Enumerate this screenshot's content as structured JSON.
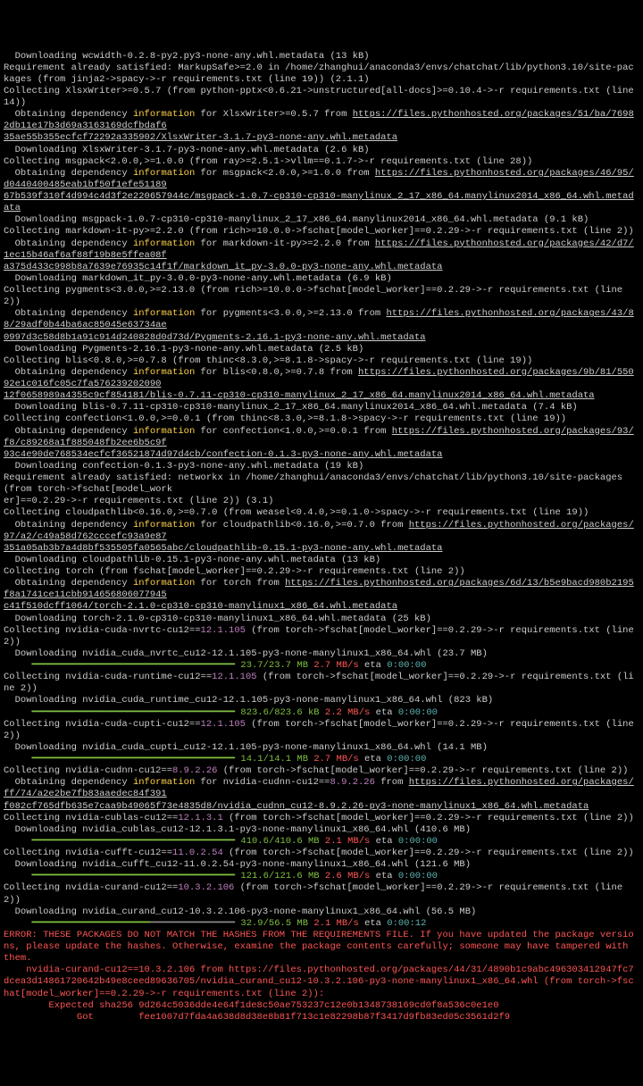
{
  "lines": [
    {
      "segs": [
        {
          "t": "  Downloading wcwidth-0.2.8-py2.py3-none-any.whl.metadata (13 kB)"
        }
      ]
    },
    {
      "segs": [
        {
          "t": "Requirement already satisfied: MarkupSafe>=2.0 in /home/zhanghui/anaconda3/envs/chatchat/lib/python3.10/site-packages (from jinja2->spacy->-r requirements.txt (line 19)) (2.1.1)"
        }
      ]
    },
    {
      "segs": [
        {
          "t": "Collecting XlsxWriter>=0.5.7 (from python-pptx<0.6.21->unstructured[all-docs]>=0.10.4->-r requirements.txt (line 14))"
        }
      ]
    },
    {
      "segs": [
        {
          "t": "  Obtaining dependency "
        },
        {
          "t": "information",
          "cls": "yellow"
        },
        {
          "t": " for XlsxWriter>=0.5.7 from "
        },
        {
          "t": "https://files.pythonhosted.org/packages/51/ba/76982db11e17b3d69a3163169dcfbdaf6",
          "cls": "underline"
        }
      ]
    },
    {
      "segs": [
        {
          "t": "35ae55b355ecfcf72292a335902/XlsxWriter-3.1.7-py3-none-any.whl.metadata",
          "cls": "underline"
        }
      ]
    },
    {
      "segs": [
        {
          "t": "  Downloading XlsxWriter-3.1.7-py3-none-any.whl.metadata (2.6 kB)"
        }
      ]
    },
    {
      "segs": [
        {
          "t": "Collecting msgpack<2.0.0,>=1.0.0 (from ray>=2.5.1->vllm==0.1.7->-r requirements.txt (line 28))"
        }
      ]
    },
    {
      "segs": [
        {
          "t": "  Obtaining dependency "
        },
        {
          "t": "information",
          "cls": "yellow"
        },
        {
          "t": " for msgpack<2.0.0,>=1.0.0 from "
        },
        {
          "t": "https://files.pythonhosted.org/packages/46/95/d0440400485eab1bf50f1efe51189",
          "cls": "underline"
        }
      ]
    },
    {
      "segs": [
        {
          "t": "67b539f310f4d994c4d3f2e220657944c/msgpack-1.0.7-cp310-cp310-manylinux_2_17_x86_64.manylinux2014_x86_64.whl.metadata",
          "cls": "underline"
        }
      ]
    },
    {
      "segs": [
        {
          "t": "  Downloading msgpack-1.0.7-cp310-cp310-manylinux_2_17_x86_64.manylinux2014_x86_64.whl.metadata (9.1 kB)"
        }
      ]
    },
    {
      "segs": [
        {
          "t": "Collecting markdown-it-py>=2.2.0 (from rich>=10.0.0->fschat[model_worker]==0.2.29->-r requirements.txt (line 2))"
        }
      ]
    },
    {
      "segs": [
        {
          "t": "  Obtaining dependency "
        },
        {
          "t": "information",
          "cls": "yellow"
        },
        {
          "t": " for markdown-it-py>=2.2.0 from "
        },
        {
          "t": "https://files.pythonhosted.org/packages/42/d7/1ec15b46af6af88f19b8e5ffea08f",
          "cls": "underline"
        }
      ]
    },
    {
      "segs": [
        {
          "t": "a375d433c998b8a7639e76935c14f1f/markdown_it_py-3.0.0-py3-none-any.whl.metadata",
          "cls": "underline"
        }
      ]
    },
    {
      "segs": [
        {
          "t": "  Downloading markdown_it_py-3.0.0-py3-none-any.whl.metadata (6.9 kB)"
        }
      ]
    },
    {
      "segs": [
        {
          "t": "Collecting pygments<3.0.0,>=2.13.0 (from rich>=10.0.0->fschat[model_worker]==0.2.29->-r requirements.txt (line 2))"
        }
      ]
    },
    {
      "segs": [
        {
          "t": "  Obtaining dependency "
        },
        {
          "t": "information",
          "cls": "yellow"
        },
        {
          "t": " for pygments<3.0.0,>=2.13.0 from "
        },
        {
          "t": "https://files.pythonhosted.org/packages/43/88/29adf0b44ba6ac85045e63734ae",
          "cls": "underline"
        }
      ]
    },
    {
      "segs": [
        {
          "t": "0997d3c58d8b1a91c914d240828d0d73d/Pygments-2.16.1-py3-none-any.whl.metadata",
          "cls": "underline"
        }
      ]
    },
    {
      "segs": [
        {
          "t": "  Downloading Pygments-2.16.1-py3-none-any.whl.metadata (2.5 kB)"
        }
      ]
    },
    {
      "segs": [
        {
          "t": "Collecting blis<0.8.0,>=0.7.8 (from thinc<8.3.0,>=8.1.8->spacy->-r requirements.txt (line 19))"
        }
      ]
    },
    {
      "segs": [
        {
          "t": "  Obtaining dependency "
        },
        {
          "t": "information",
          "cls": "yellow"
        },
        {
          "t": " for blis<0.8.0,>=0.7.8 from "
        },
        {
          "t": "https://files.pythonhosted.org/packages/9b/81/55092e1c016fc05c7fa576239202090",
          "cls": "underline"
        }
      ]
    },
    {
      "segs": [
        {
          "t": "12f0658989a4355c9cf854181/blis-0.7.11-cp310-cp310-manylinux_2_17_x86_64.manylinux2014_x86_64.whl.metadata",
          "cls": "underline"
        }
      ]
    },
    {
      "segs": [
        {
          "t": "  Downloading blis-0.7.11-cp310-cp310-manylinux_2_17_x86_64.manylinux2014_x86_64.whl.metadata (7.4 kB)"
        }
      ]
    },
    {
      "segs": [
        {
          "t": "Collecting confection<1.0.0,>=0.0.1 (from thinc<8.3.0,>=8.1.8->spacy->-r requirements.txt (line 19))"
        }
      ]
    },
    {
      "segs": [
        {
          "t": "  Obtaining dependency "
        },
        {
          "t": "information",
          "cls": "yellow"
        },
        {
          "t": " for confection<1.0.0,>=0.0.1 from "
        },
        {
          "t": "https://files.pythonhosted.org/packages/93/f8/c89268a1f885048fb2ee6b5c9f",
          "cls": "underline"
        }
      ]
    },
    {
      "segs": [
        {
          "t": "93c4e90de768534ecfcf36521874d97d4cb/confection-0.1.3-py3-none-any.whl.metadata",
          "cls": "underline"
        }
      ]
    },
    {
      "segs": [
        {
          "t": "  Downloading confection-0.1.3-py3-none-any.whl.metadata (19 kB)"
        }
      ]
    },
    {
      "segs": [
        {
          "t": "Requirement already satisfied: networkx in /home/zhanghui/anaconda3/envs/chatchat/lib/python3.10/site-packages (from torch->fschat[model_work"
        }
      ]
    },
    {
      "segs": [
        {
          "t": "er]==0.2.29->-r requirements.txt (line 2)) (3.1)"
        }
      ]
    },
    {
      "segs": [
        {
          "t": "Collecting cloudpathlib<0.16.0,>=0.7.0 (from weasel<0.4.0,>=0.1.0->spacy->-r requirements.txt (line 19))"
        }
      ]
    },
    {
      "segs": [
        {
          "t": "  Obtaining dependency "
        },
        {
          "t": "information",
          "cls": "yellow"
        },
        {
          "t": " for cloudpathlib<0.16.0,>=0.7.0 from "
        },
        {
          "t": "https://files.pythonhosted.org/packages/97/a2/c49a58d762cccefc93a9e87",
          "cls": "underline"
        }
      ]
    },
    {
      "segs": [
        {
          "t": "351a05ab3b7a4d8bf535505fa0565abc/cloudpathlib-0.15.1-py3-none-any.whl.metadata",
          "cls": "underline"
        }
      ]
    },
    {
      "segs": [
        {
          "t": "  Downloading cloudpathlib-0.15.1-py3-none-any.whl.metadata (13 kB)"
        }
      ]
    },
    {
      "segs": [
        {
          "t": "Collecting torch (from fschat[model_worker]==0.2.29->-r requirements.txt (line 2))"
        }
      ]
    },
    {
      "segs": [
        {
          "t": "  Obtaining dependency "
        },
        {
          "t": "information",
          "cls": "yellow"
        },
        {
          "t": " for torch from "
        },
        {
          "t": "https://files.pythonhosted.org/packages/6d/13/b5e9bacd980b2195f8a1741ce11cbb914656806077945",
          "cls": "underline"
        }
      ]
    },
    {
      "segs": [
        {
          "t": "c41f510dcff1064/torch-2.1.0-cp310-cp310-manylinux1_x86_64.whl.metadata",
          "cls": "underline"
        }
      ]
    },
    {
      "segs": [
        {
          "t": "  Downloading torch-2.1.0-cp310-cp310-manylinux1_x86_64.whl.metadata (25 kB)"
        }
      ]
    },
    {
      "segs": [
        {
          "t": "Collecting nvidia-cuda-nvrtc-cu12=="
        },
        {
          "t": "12.1.105",
          "cls": "purple"
        },
        {
          "t": " (from torch->fschat[model_worker]==0.2.29->-r requirements.txt (line 2))"
        }
      ]
    },
    {
      "segs": [
        {
          "t": "  Downloading nvidia_cuda_nvrtc_cu12-12.1.105-py3-none-manylinux1_x86_64.whl (23.7 MB)"
        }
      ]
    },
    {
      "segs": [
        {
          "t": "     "
        },
        {
          "t": "━━━━━━━━━━━━━━━━━━━━━━━━━━━━━━━━━━━━ 23.7/23.7 MB",
          "cls": "green"
        },
        {
          "t": " "
        },
        {
          "t": "2.7 MB/s",
          "cls": "redb"
        },
        {
          "t": " eta "
        },
        {
          "t": "0:00:00",
          "cls": "teal"
        }
      ]
    },
    {
      "segs": [
        {
          "t": "Collecting nvidia-cuda-runtime-cu12=="
        },
        {
          "t": "12.1.105",
          "cls": "purple"
        },
        {
          "t": " (from torch->fschat[model_worker]==0.2.29->-r requirements.txt (line 2))"
        }
      ]
    },
    {
      "segs": [
        {
          "t": "  Downloading nvidia_cuda_runtime_cu12-12.1.105-py3-none-manylinux1_x86_64.whl (823 kB)"
        }
      ]
    },
    {
      "segs": [
        {
          "t": "     "
        },
        {
          "t": "━━━━━━━━━━━━━━━━━━━━━━━━━━━━━━━━━━━━ 823.6/823.6 kB",
          "cls": "green"
        },
        {
          "t": " "
        },
        {
          "t": "2.2 MB/s",
          "cls": "redb"
        },
        {
          "t": " eta "
        },
        {
          "t": "0:00:00",
          "cls": "teal"
        }
      ]
    },
    {
      "segs": [
        {
          "t": "Collecting nvidia-cuda-cupti-cu12=="
        },
        {
          "t": "12.1.105",
          "cls": "purple"
        },
        {
          "t": " (from torch->fschat[model_worker]==0.2.29->-r requirements.txt (line 2))"
        }
      ]
    },
    {
      "segs": [
        {
          "t": "  Downloading nvidia_cuda_cupti_cu12-12.1.105-py3-none-manylinux1_x86_64.whl (14.1 MB)"
        }
      ]
    },
    {
      "segs": [
        {
          "t": "     "
        },
        {
          "t": "━━━━━━━━━━━━━━━━━━━━━━━━━━━━━━━━━━━━ 14.1/14.1 MB",
          "cls": "green"
        },
        {
          "t": " "
        },
        {
          "t": "2.7 MB/s",
          "cls": "redb"
        },
        {
          "t": " eta "
        },
        {
          "t": "0:00:00",
          "cls": "teal"
        }
      ]
    },
    {
      "segs": [
        {
          "t": "Collecting nvidia-cudnn-cu12=="
        },
        {
          "t": "8.9.2.26",
          "cls": "purple"
        },
        {
          "t": " (from torch->fschat[model_worker]==0.2.29->-r requirements.txt (line 2))"
        }
      ]
    },
    {
      "segs": [
        {
          "t": "  Obtaining dependency "
        },
        {
          "t": "information",
          "cls": "yellow"
        },
        {
          "t": " for nvidia-cudnn-cu12=="
        },
        {
          "t": "8.9.2.26",
          "cls": "purple"
        },
        {
          "t": " from "
        },
        {
          "t": "https://files.pythonhosted.org/packages/ff/74/a2e2be7fb83aaedec84f391",
          "cls": "underline"
        }
      ]
    },
    {
      "segs": [
        {
          "t": "f082cf765dfb635e7caa9b49065f73e4835d8/nvidia_cudnn_cu12-8.9.2.26-py3-none-manylinux1_x86_64.whl.metadata",
          "cls": "underline"
        }
      ]
    },
    {
      "segs": [
        {
          "t": "Collecting nvidia-cublas-cu12=="
        },
        {
          "t": "12.1.3.1",
          "cls": "purple"
        },
        {
          "t": " (from torch->fschat[model_worker]==0.2.29->-r requirements.txt (line 2))"
        }
      ]
    },
    {
      "segs": [
        {
          "t": "  Downloading nvidia_cublas_cu12-12.1.3.1-py3-none-manylinux1_x86_64.whl (410.6 MB)"
        }
      ]
    },
    {
      "segs": [
        {
          "t": "     "
        },
        {
          "t": "━━━━━━━━━━━━━━━━━━━━━━━━━━━━━━━━━━━━ 410.6/410.6 MB",
          "cls": "green"
        },
        {
          "t": " "
        },
        {
          "t": "2.1 MB/s",
          "cls": "redb"
        },
        {
          "t": " eta "
        },
        {
          "t": "0:00:00",
          "cls": "teal"
        }
      ]
    },
    {
      "segs": [
        {
          "t": "Collecting nvidia-cufft-cu12=="
        },
        {
          "t": "11.0.2.54",
          "cls": "purple"
        },
        {
          "t": " (from torch->fschat[model_worker]==0.2.29->-r requirements.txt (line 2))"
        }
      ]
    },
    {
      "segs": [
        {
          "t": "  Downloading nvidia_cufft_cu12-11.0.2.54-py3-none-manylinux1_x86_64.whl (121.6 MB)"
        }
      ]
    },
    {
      "segs": [
        {
          "t": "     "
        },
        {
          "t": "━━━━━━━━━━━━━━━━━━━━━━━━━━━━━━━━━━━━ 121.6/121.6 MB",
          "cls": "green"
        },
        {
          "t": " "
        },
        {
          "t": "2.6 MB/s",
          "cls": "redb"
        },
        {
          "t": " eta "
        },
        {
          "t": "0:00:00",
          "cls": "teal"
        }
      ]
    },
    {
      "segs": [
        {
          "t": "Collecting nvidia-curand-cu12=="
        },
        {
          "t": "10.3.2.106",
          "cls": "purple"
        },
        {
          "t": " (from torch->fschat[model_worker]==0.2.29->-r requirements.txt (line 2))"
        }
      ]
    },
    {
      "segs": [
        {
          "t": "  Downloading nvidia_curand_cu12-10.3.2.106-py3-none-manylinux1_x86_64.whl (56.5 MB)"
        }
      ]
    },
    {
      "segs": [
        {
          "t": "     "
        },
        {
          "t": "━━━━━━━━━━━━━━━━━━━━━",
          "cls": "green"
        },
        {
          "t": "━━━━━━━━━━━━━━━ ",
          "cls": "faint"
        },
        {
          "t": "32.9/56.5 MB",
          "cls": "green"
        },
        {
          "t": " "
        },
        {
          "t": "2.1 MB/s",
          "cls": "redb"
        },
        {
          "t": " eta "
        },
        {
          "t": "0:00:12",
          "cls": "teal"
        }
      ]
    },
    {
      "segs": [
        {
          "t": "ERROR: THESE PACKAGES DO NOT MATCH THE HASHES FROM THE REQUIREMENTS FILE. If you have updated the package versions, please update the hashes. Otherwise, examine the package contents carefully; someone may have tampered with them.",
          "cls": "redb"
        }
      ]
    },
    {
      "segs": [
        {
          "t": "    nvidia-curand-cu12==10.3.2.106 from https://files.pythonhosted.org/packages/44/31/4890b1c9abc496303412947fc7dcea3d14861720642b49e8ceed89636705/nvidia_curand_cu12-10.3.2.106-py3-none-manylinux1_x86_64.whl (from torch->fschat[model_worker]==0.2.29->-r requirements.txt (line 2)):",
          "cls": "redb"
        }
      ]
    },
    {
      "segs": [
        {
          "t": "        Expected sha256 9d264c5036dde4e64f1de8c50ae753237c12e0b1348738169cd0f8a536c0e1e0",
          "cls": "redb"
        }
      ]
    },
    {
      "segs": [
        {
          "t": "             Got        fee1007d7fda4a638d8d38e8b81f713c1e82298b87f3417d9fb83ed05c3561d2f9",
          "cls": "redb"
        }
      ]
    }
  ]
}
